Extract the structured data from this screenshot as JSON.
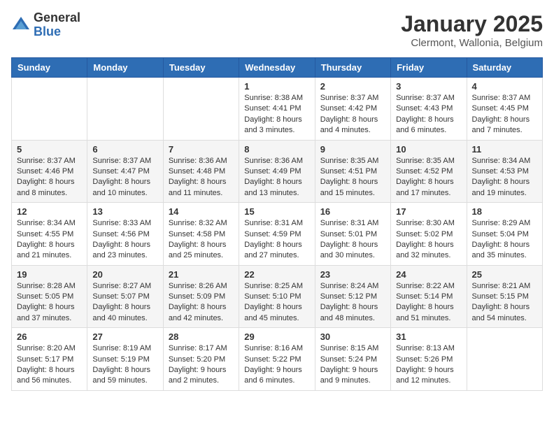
{
  "header": {
    "logo_general": "General",
    "logo_blue": "Blue",
    "month_title": "January 2025",
    "location": "Clermont, Wallonia, Belgium"
  },
  "days_of_week": [
    "Sunday",
    "Monday",
    "Tuesday",
    "Wednesday",
    "Thursday",
    "Friday",
    "Saturday"
  ],
  "weeks": [
    [
      {
        "day": "",
        "sunrise": "",
        "sunset": "",
        "daylight": ""
      },
      {
        "day": "",
        "sunrise": "",
        "sunset": "",
        "daylight": ""
      },
      {
        "day": "",
        "sunrise": "",
        "sunset": "",
        "daylight": ""
      },
      {
        "day": "1",
        "sunrise": "Sunrise: 8:38 AM",
        "sunset": "Sunset: 4:41 PM",
        "daylight": "Daylight: 8 hours and 3 minutes."
      },
      {
        "day": "2",
        "sunrise": "Sunrise: 8:37 AM",
        "sunset": "Sunset: 4:42 PM",
        "daylight": "Daylight: 8 hours and 4 minutes."
      },
      {
        "day": "3",
        "sunrise": "Sunrise: 8:37 AM",
        "sunset": "Sunset: 4:43 PM",
        "daylight": "Daylight: 8 hours and 6 minutes."
      },
      {
        "day": "4",
        "sunrise": "Sunrise: 8:37 AM",
        "sunset": "Sunset: 4:45 PM",
        "daylight": "Daylight: 8 hours and 7 minutes."
      }
    ],
    [
      {
        "day": "5",
        "sunrise": "Sunrise: 8:37 AM",
        "sunset": "Sunset: 4:46 PM",
        "daylight": "Daylight: 8 hours and 8 minutes."
      },
      {
        "day": "6",
        "sunrise": "Sunrise: 8:37 AM",
        "sunset": "Sunset: 4:47 PM",
        "daylight": "Daylight: 8 hours and 10 minutes."
      },
      {
        "day": "7",
        "sunrise": "Sunrise: 8:36 AM",
        "sunset": "Sunset: 4:48 PM",
        "daylight": "Daylight: 8 hours and 11 minutes."
      },
      {
        "day": "8",
        "sunrise": "Sunrise: 8:36 AM",
        "sunset": "Sunset: 4:49 PM",
        "daylight": "Daylight: 8 hours and 13 minutes."
      },
      {
        "day": "9",
        "sunrise": "Sunrise: 8:35 AM",
        "sunset": "Sunset: 4:51 PM",
        "daylight": "Daylight: 8 hours and 15 minutes."
      },
      {
        "day": "10",
        "sunrise": "Sunrise: 8:35 AM",
        "sunset": "Sunset: 4:52 PM",
        "daylight": "Daylight: 8 hours and 17 minutes."
      },
      {
        "day": "11",
        "sunrise": "Sunrise: 8:34 AM",
        "sunset": "Sunset: 4:53 PM",
        "daylight": "Daylight: 8 hours and 19 minutes."
      }
    ],
    [
      {
        "day": "12",
        "sunrise": "Sunrise: 8:34 AM",
        "sunset": "Sunset: 4:55 PM",
        "daylight": "Daylight: 8 hours and 21 minutes."
      },
      {
        "day": "13",
        "sunrise": "Sunrise: 8:33 AM",
        "sunset": "Sunset: 4:56 PM",
        "daylight": "Daylight: 8 hours and 23 minutes."
      },
      {
        "day": "14",
        "sunrise": "Sunrise: 8:32 AM",
        "sunset": "Sunset: 4:58 PM",
        "daylight": "Daylight: 8 hours and 25 minutes."
      },
      {
        "day": "15",
        "sunrise": "Sunrise: 8:31 AM",
        "sunset": "Sunset: 4:59 PM",
        "daylight": "Daylight: 8 hours and 27 minutes."
      },
      {
        "day": "16",
        "sunrise": "Sunrise: 8:31 AM",
        "sunset": "Sunset: 5:01 PM",
        "daylight": "Daylight: 8 hours and 30 minutes."
      },
      {
        "day": "17",
        "sunrise": "Sunrise: 8:30 AM",
        "sunset": "Sunset: 5:02 PM",
        "daylight": "Daylight: 8 hours and 32 minutes."
      },
      {
        "day": "18",
        "sunrise": "Sunrise: 8:29 AM",
        "sunset": "Sunset: 5:04 PM",
        "daylight": "Daylight: 8 hours and 35 minutes."
      }
    ],
    [
      {
        "day": "19",
        "sunrise": "Sunrise: 8:28 AM",
        "sunset": "Sunset: 5:05 PM",
        "daylight": "Daylight: 8 hours and 37 minutes."
      },
      {
        "day": "20",
        "sunrise": "Sunrise: 8:27 AM",
        "sunset": "Sunset: 5:07 PM",
        "daylight": "Daylight: 8 hours and 40 minutes."
      },
      {
        "day": "21",
        "sunrise": "Sunrise: 8:26 AM",
        "sunset": "Sunset: 5:09 PM",
        "daylight": "Daylight: 8 hours and 42 minutes."
      },
      {
        "day": "22",
        "sunrise": "Sunrise: 8:25 AM",
        "sunset": "Sunset: 5:10 PM",
        "daylight": "Daylight: 8 hours and 45 minutes."
      },
      {
        "day": "23",
        "sunrise": "Sunrise: 8:24 AM",
        "sunset": "Sunset: 5:12 PM",
        "daylight": "Daylight: 8 hours and 48 minutes."
      },
      {
        "day": "24",
        "sunrise": "Sunrise: 8:22 AM",
        "sunset": "Sunset: 5:14 PM",
        "daylight": "Daylight: 8 hours and 51 minutes."
      },
      {
        "day": "25",
        "sunrise": "Sunrise: 8:21 AM",
        "sunset": "Sunset: 5:15 PM",
        "daylight": "Daylight: 8 hours and 54 minutes."
      }
    ],
    [
      {
        "day": "26",
        "sunrise": "Sunrise: 8:20 AM",
        "sunset": "Sunset: 5:17 PM",
        "daylight": "Daylight: 8 hours and 56 minutes."
      },
      {
        "day": "27",
        "sunrise": "Sunrise: 8:19 AM",
        "sunset": "Sunset: 5:19 PM",
        "daylight": "Daylight: 8 hours and 59 minutes."
      },
      {
        "day": "28",
        "sunrise": "Sunrise: 8:17 AM",
        "sunset": "Sunset: 5:20 PM",
        "daylight": "Daylight: 9 hours and 2 minutes."
      },
      {
        "day": "29",
        "sunrise": "Sunrise: 8:16 AM",
        "sunset": "Sunset: 5:22 PM",
        "daylight": "Daylight: 9 hours and 6 minutes."
      },
      {
        "day": "30",
        "sunrise": "Sunrise: 8:15 AM",
        "sunset": "Sunset: 5:24 PM",
        "daylight": "Daylight: 9 hours and 9 minutes."
      },
      {
        "day": "31",
        "sunrise": "Sunrise: 8:13 AM",
        "sunset": "Sunset: 5:26 PM",
        "daylight": "Daylight: 9 hours and 12 minutes."
      },
      {
        "day": "",
        "sunrise": "",
        "sunset": "",
        "daylight": ""
      }
    ]
  ]
}
